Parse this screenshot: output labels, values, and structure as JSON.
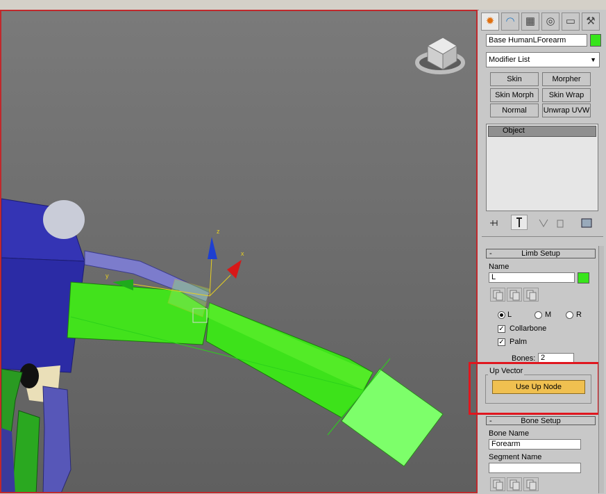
{
  "command_panel": {
    "tabs": [
      {
        "name": "create-tab-icon",
        "glyph": "✹"
      },
      {
        "name": "modify-tab-icon",
        "glyph": "◠"
      },
      {
        "name": "hierarchy-tab-icon",
        "glyph": "▦"
      },
      {
        "name": "motion-tab-icon",
        "glyph": "◎"
      },
      {
        "name": "display-tab-icon",
        "glyph": "▭"
      },
      {
        "name": "utilities-tab-icon",
        "glyph": "⚒"
      }
    ],
    "object_name": "Base HumanLForearm",
    "object_color": "#37e51b",
    "modifier_list": "Modifier List",
    "modifier_buttons": [
      "Skin",
      "Morpher",
      "Skin Morph",
      "Skin Wrap",
      "Normal",
      "Unwrap UVW"
    ],
    "stack_item": "Object"
  },
  "limb_setup": {
    "title": "Limb Setup",
    "name_label": "Name",
    "name_value": "L",
    "radio_l": "L",
    "radio_m": "M",
    "radio_r": "R",
    "collarbone_label": "Collarbone",
    "palm_label": "Palm",
    "bones_label": "Bones:",
    "bones_value": "2",
    "up_vector_label": "Up Vector",
    "use_up_node_label": "Use Up Node"
  },
  "bone_setup": {
    "title": "Bone Setup",
    "bone_name_label": "Bone Name",
    "bone_name_value": "Forearm",
    "segment_name_label": "Segment Name",
    "segment_name_value": ""
  },
  "gizmo": {
    "x_label": "x",
    "y_label": "y",
    "z_label": "z"
  },
  "colors": {
    "highlight_box": "#e0161e",
    "use_up_node_bg": "#f0c050",
    "bone_green": "#3de21a",
    "arm_blue": "#2e2ea8"
  }
}
